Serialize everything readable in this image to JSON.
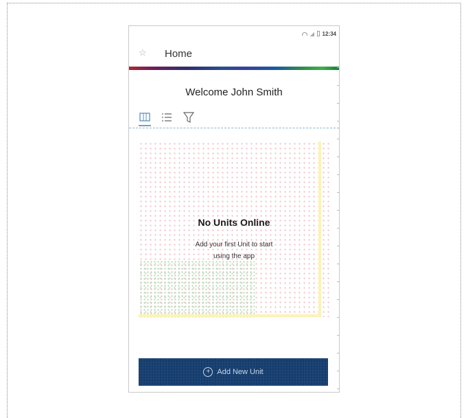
{
  "statusbar": {
    "time": "12:34"
  },
  "appbar": {
    "title": "Home",
    "star_icon": "star-icon"
  },
  "welcome": "Welcome John Smith",
  "tabs": [
    {
      "icon": "map-icon",
      "active": true
    },
    {
      "icon": "list-icon",
      "active": false
    },
    {
      "icon": "filter-icon",
      "active": false
    }
  ],
  "empty_state": {
    "title": "No Units Online",
    "subtitle_line1": "Add your first Unit to start",
    "subtitle_line2": "using the app"
  },
  "add_button": {
    "label": "Add New Unit",
    "icon": "plus-circle-icon"
  },
  "colors": {
    "primary": "#153d6e",
    "tab_accent": "#6ea0c8",
    "rainbow_start": "#b0262e",
    "rainbow_end": "#1d7d3a"
  }
}
